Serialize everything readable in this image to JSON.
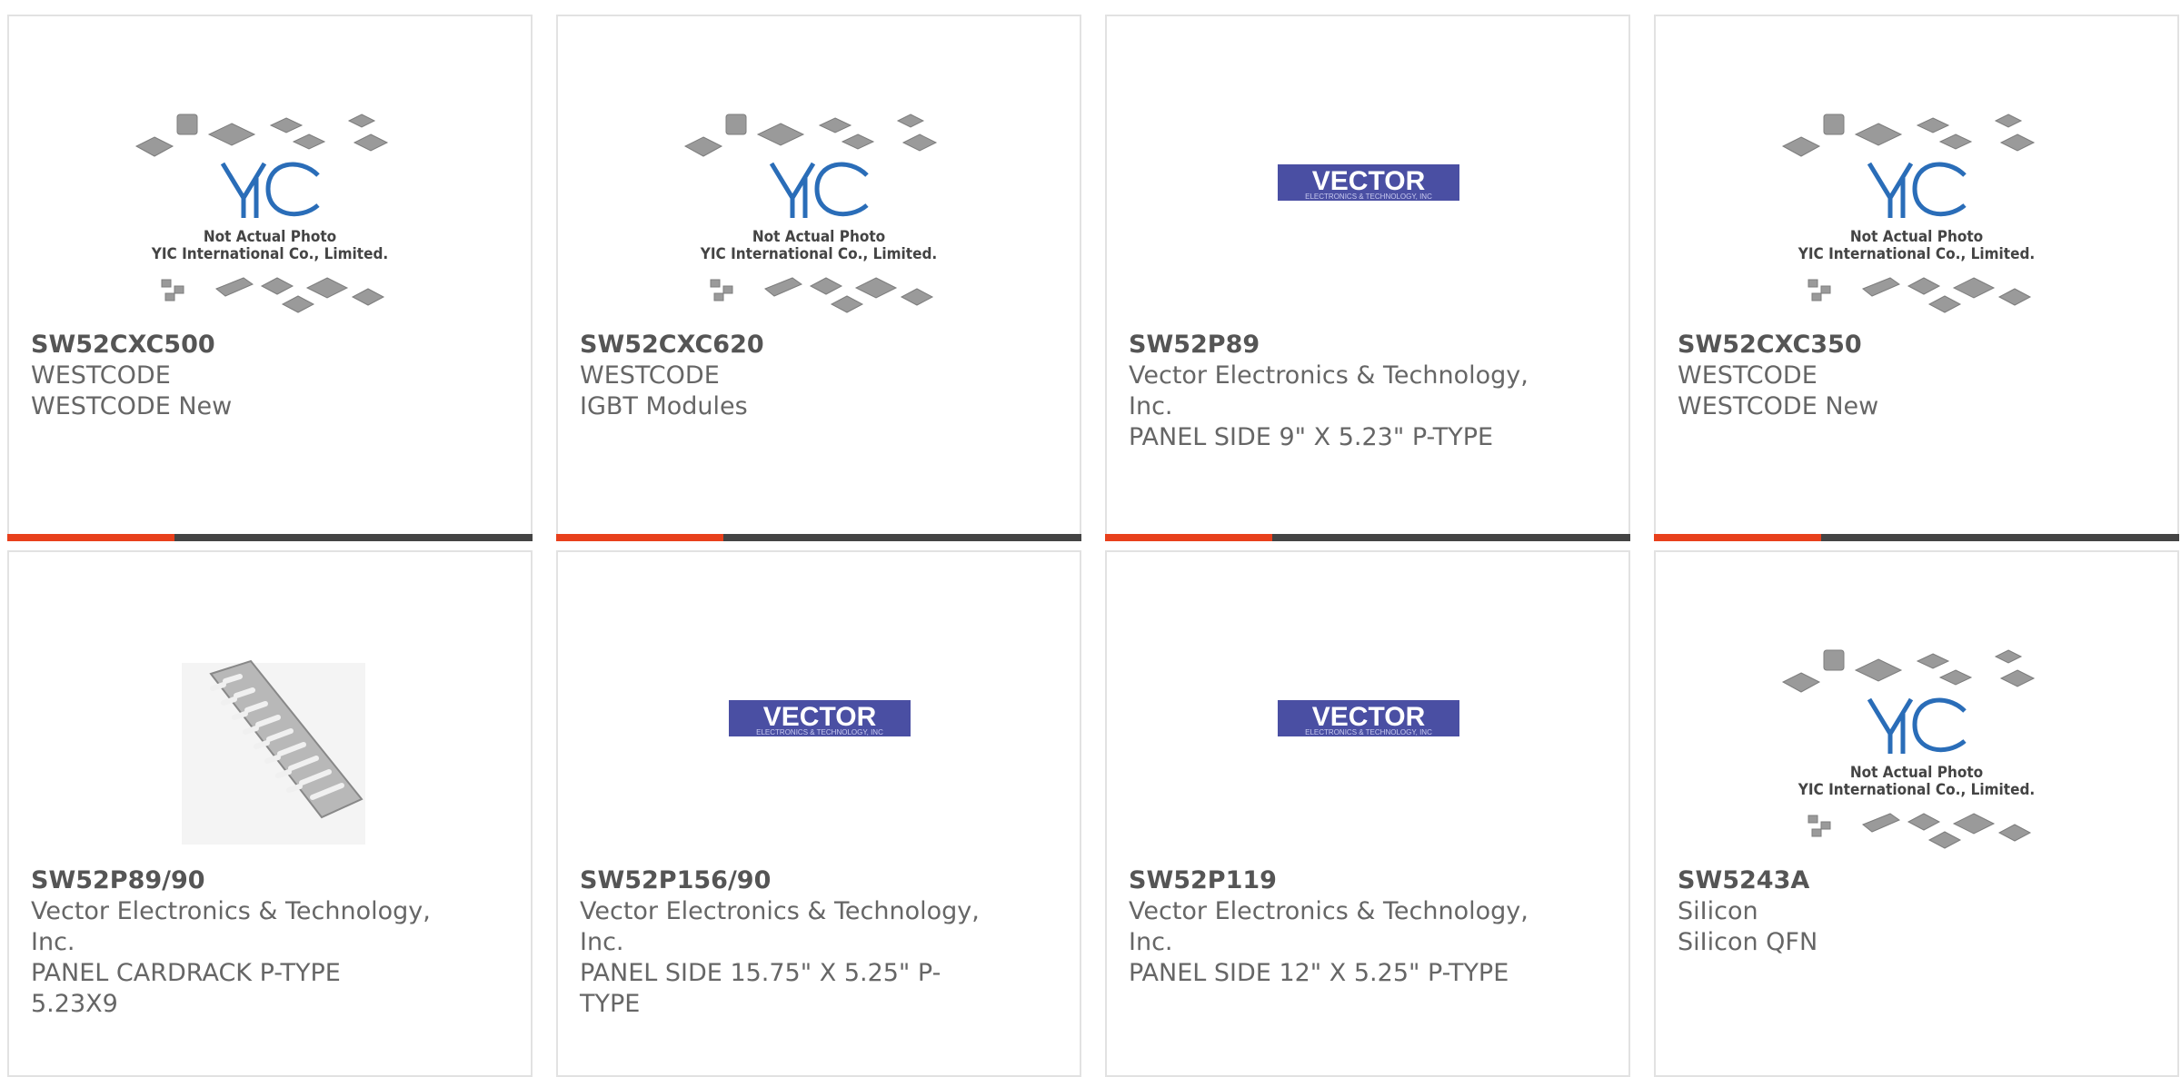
{
  "colors": {
    "accent": "#e8401c",
    "bar": "#444444",
    "vector_blue": "#4a4fa3",
    "yic_blue": "#2a6db8"
  },
  "placeholder_image": {
    "line1": "Not Actual Photo",
    "line2": "YIC International Co., Limited.",
    "logo": "YIC"
  },
  "vector_logo": {
    "name": "VECTOR",
    "sub": "ELECTRONICS & TECHNOLOGY, INC"
  },
  "products": [
    {
      "part": "SW52CXC500",
      "manufacturer": "WESTCODE",
      "description": "WESTCODE New",
      "image": "yic-placeholder"
    },
    {
      "part": "SW52CXC620",
      "manufacturer": "WESTCODE",
      "description": "IGBT Modules",
      "image": "yic-placeholder"
    },
    {
      "part": "SW52P89",
      "manufacturer_l1": "Vector Electronics & Technology,",
      "manufacturer_l2": "Inc.",
      "description": "PANEL SIDE 9\" X 5.23\" P-TYPE",
      "image": "vector-logo"
    },
    {
      "part": "SW52CXC350",
      "manufacturer": "WESTCODE",
      "description": "WESTCODE New",
      "image": "yic-placeholder"
    },
    {
      "part": "SW52P89/90",
      "manufacturer_l1": "Vector Electronics & Technology,",
      "manufacturer_l2": "Inc.",
      "description": "PANEL CARDRACK P-TYPE 5.23X9",
      "image": "card-rack-photo"
    },
    {
      "part": "SW52P156/90",
      "manufacturer_l1": "Vector Electronics & Technology,",
      "manufacturer_l2": "Inc.",
      "description_l1": "PANEL SIDE 15.75\" X 5.25\" P-",
      "description_l2": "TYPE",
      "image": "vector-logo"
    },
    {
      "part": "SW52P119",
      "manufacturer_l1": "Vector Electronics & Technology,",
      "manufacturer_l2": "Inc.",
      "description": "PANEL SIDE 12\" X 5.25\" P-TYPE",
      "image": "vector-logo"
    },
    {
      "part": "SW5243A",
      "manufacturer": "SiIicon",
      "description": "SiIicon QFN",
      "image": "yic-placeholder"
    }
  ]
}
